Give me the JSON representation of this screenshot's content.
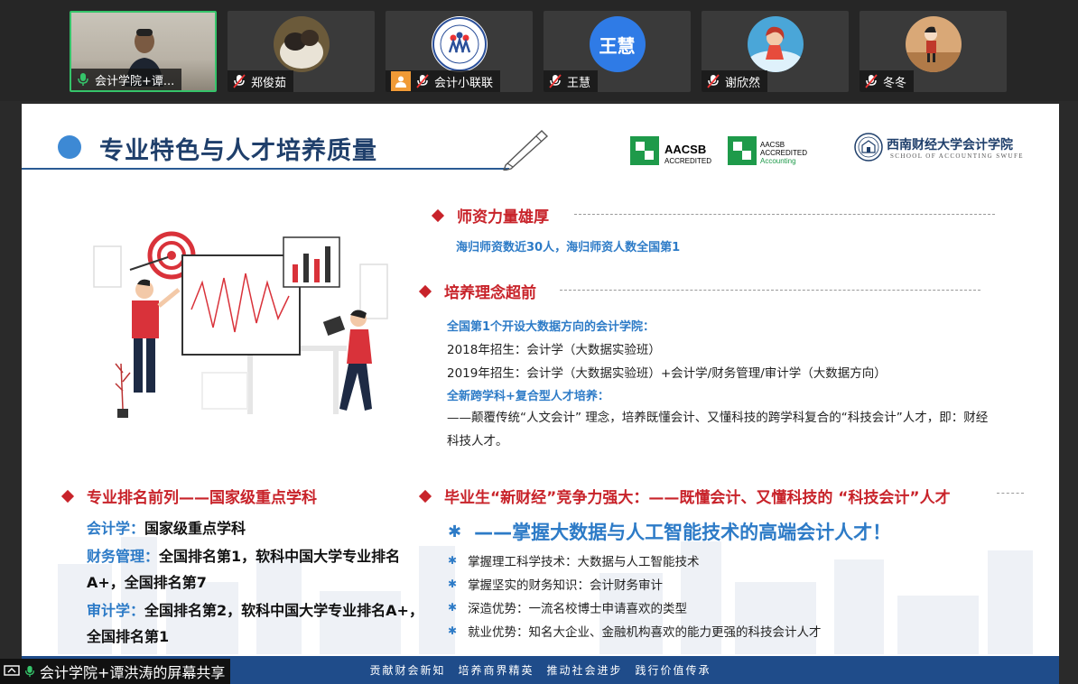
{
  "participants": [
    {
      "name": "会计学院+谭...",
      "type": "video",
      "active": true
    },
    {
      "name": "郑俊茹",
      "type": "avatar-photo"
    },
    {
      "name": "会计小联联",
      "type": "avatar-logo",
      "user_icon": true
    },
    {
      "name": "王慧",
      "type": "avatar-text",
      "avatar_text": "王慧"
    },
    {
      "name": "谢欣然",
      "type": "avatar-photo"
    },
    {
      "name": "冬冬",
      "type": "avatar-photo"
    }
  ],
  "slide": {
    "title": "专业特色与人才培养质量",
    "logos": {
      "aacsb_main": "AACSB",
      "aacsb_sub": "ACCREDITED",
      "aacsb2_main": "AACSB",
      "aacsb2_sub": "ACCREDITED",
      "aacsb2_sub2": "Accounting",
      "school_cn": "西南财经大学会计学院",
      "school_en": "SCHOOL OF ACCOUNTING SWUFE"
    },
    "faculty": {
      "heading": "师资力量雄厚",
      "text": "海归师资数近30人，海归师资人数全国第1"
    },
    "concept": {
      "heading": "培养理念超前",
      "line1": "全国第1个开设大数据方向的会计学院：",
      "line2": "2018年招生：会计学（大数据实验班）",
      "line3": "2019年招生：会计学（大数据实验班）+会计学/财务管理/审计学（大数据方向）",
      "line4": "全新跨学科+复合型人才培养：",
      "line5": "——颠覆传统“人文会计” 理念，培养既懂会计、又懂科技的跨学科复合的“科技会计”人才，即：财经科技人才。"
    },
    "ranking": {
      "heading": "专业排名前列——国家级重点学科",
      "items": [
        {
          "key": "会计学：",
          "value": "国家级重点学科"
        },
        {
          "key": "财务管理：",
          "value": "全国排名第1，软科中国大学专业排名A+，全国排名第7"
        },
        {
          "key": "审计学：",
          "value": "全国排名第2，软科中国大学专业排名A+，全国排名第1"
        }
      ]
    },
    "graduates": {
      "heading": "毕业生“新财经”竞争力强大：——既懂会计、又懂科技的 “科技会计”人才",
      "highlight": "——掌握大数据与人工智能技术的高端会计人才！",
      "bullets": [
        "掌握理工科学技术：大数据与人工智能技术",
        "掌握坚实的财务知识：会计财务审计",
        "深造优势：一流名校博士申请喜欢的类型",
        "就业优势：知名大企业、金融机构喜欢的能力更强的科技会计人才"
      ]
    },
    "footer": [
      "贡献财会新知",
      "培养商界精英",
      "推动社会进步",
      "践行价值传承"
    ]
  },
  "share_badge": "会计学院+谭洪涛的屏幕共享",
  "colors": {
    "title": "#1f3f6b",
    "accent_red": "#c8232a",
    "accent_blue": "#2d7bc7",
    "footer": "#1f4c8a",
    "active_border": "#35c46a"
  }
}
